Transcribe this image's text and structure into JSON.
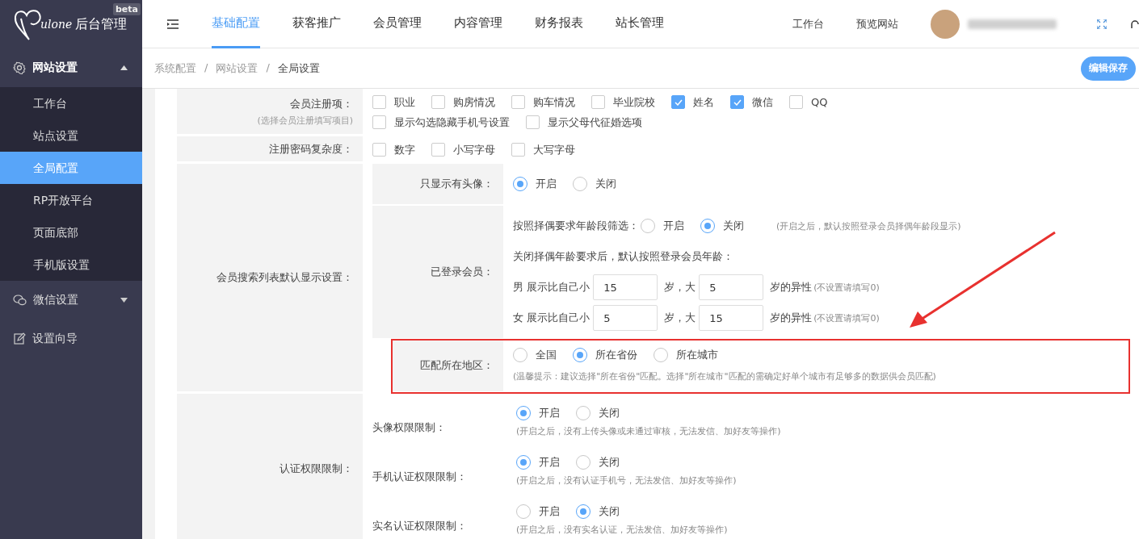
{
  "sidebar": {
    "logo": {
      "script": "ulone",
      "title": "后台管理",
      "badge": "beta"
    },
    "groups": [
      {
        "label": "网站设置",
        "kind": "submenu",
        "expanded": true,
        "children": [
          {
            "label": "工作台",
            "selected": false
          },
          {
            "label": "站点设置",
            "selected": false
          },
          {
            "label": "全局配置",
            "selected": true
          },
          {
            "label": "RP开放平台",
            "selected": false
          },
          {
            "label": "页面底部",
            "selected": false
          },
          {
            "label": "手机版设置",
            "selected": false
          }
        ]
      },
      {
        "label": "微信设置",
        "kind": "submenu",
        "expanded": false
      },
      {
        "label": "设置向导",
        "kind": "link"
      }
    ]
  },
  "top_nav": {
    "tabs": [
      {
        "label": "基础配置",
        "selected": true
      },
      {
        "label": "获客推广",
        "selected": false
      },
      {
        "label": "会员管理",
        "selected": false
      },
      {
        "label": "内容管理",
        "selected": false
      },
      {
        "label": "财务报表",
        "selected": false
      },
      {
        "label": "站长管理",
        "selected": false
      }
    ],
    "links": [
      "工作台",
      "预览网站"
    ]
  },
  "breadcrumb": {
    "items": [
      "系统配置",
      "网站设置",
      "全局设置"
    ],
    "separator": "/"
  },
  "save_button": "编辑保存",
  "form": [
    {
      "kind": "checks",
      "label": "会员注册项：",
      "hint": "(选择会员注册填写项目)",
      "lines": [
        [
          {
            "label": "职业",
            "checked": false
          },
          {
            "label": "购房情况",
            "checked": false
          },
          {
            "label": "购车情况",
            "checked": false
          },
          {
            "label": "毕业院校",
            "checked": false
          },
          {
            "label": "姓名",
            "checked": true
          },
          {
            "label": "微信",
            "checked": true
          },
          {
            "label": "QQ",
            "checked": false
          }
        ],
        [
          {
            "label": "显示勾选隐藏手机号设置",
            "checked": false
          },
          {
            "label": "显示父母代征婚选项",
            "checked": false
          }
        ]
      ]
    },
    {
      "kind": "checks",
      "label": "注册密码复杂度：",
      "lines": [
        [
          {
            "label": "数字",
            "checked": false
          },
          {
            "label": "小写字母",
            "checked": false
          },
          {
            "label": "大写字母",
            "checked": false
          }
        ]
      ]
    },
    {
      "kind": "nested",
      "label": "会员搜索列表默认显示设置：",
      "rows": [
        {
          "label": "只显示有头像：",
          "highlighted": false,
          "lines": [
            [
              {
                "kind": "radios",
                "options": [
                  {
                    "label": "开启",
                    "selected": true
                  },
                  {
                    "label": "关闭",
                    "selected": false
                  }
                ]
              }
            ]
          ]
        },
        {
          "label": "已登录会员：",
          "highlighted": false,
          "lines": [
            [
              {
                "kind": "text",
                "text": "按照择偶要求年龄段筛选："
              },
              {
                "kind": "radios",
                "options": [
                  {
                    "label": "开启",
                    "selected": false
                  },
                  {
                    "label": "关闭",
                    "selected": true
                  }
                ]
              },
              {
                "kind": "note",
                "text": "(开启之后，默认按照登录会员择偶年龄段显示)"
              }
            ],
            [
              {
                "kind": "text",
                "text": "关闭择偶年龄要求后，默认按照登录会员年龄："
              }
            ],
            [
              {
                "kind": "text",
                "text": "男 展示比自己小"
              },
              {
                "kind": "input",
                "value": "15"
              },
              {
                "kind": "text",
                "text": "岁，大"
              },
              {
                "kind": "input",
                "value": "5"
              },
              {
                "kind": "text",
                "text": "岁的异性"
              },
              {
                "kind": "note",
                "text": "(不设置请填写0)"
              }
            ],
            [
              {
                "kind": "text",
                "text": "女 展示比自己小"
              },
              {
                "kind": "input",
                "value": "5"
              },
              {
                "kind": "text",
                "text": "岁，大"
              },
              {
                "kind": "input",
                "value": "15"
              },
              {
                "kind": "text",
                "text": "岁的异性"
              },
              {
                "kind": "note",
                "text": "(不设置请填写0)"
              }
            ]
          ]
        },
        {
          "label": "匹配所在地区：",
          "highlighted": true,
          "lines": [
            [
              {
                "kind": "radios",
                "options": [
                  {
                    "label": "全国",
                    "selected": false
                  },
                  {
                    "label": "所在省份",
                    "selected": true
                  },
                  {
                    "label": "所在城市",
                    "selected": false
                  }
                ]
              }
            ],
            [
              {
                "kind": "note",
                "text": "(温馨提示：建议选择\"所在省份\"匹配。选择\"所在城市\"匹配的需确定好单个城市有足够多的数据供会员匹配)"
              }
            ]
          ]
        }
      ]
    },
    {
      "kind": "items",
      "label": "认证权限限制：",
      "items": [
        {
          "label": "头像权限限制：",
          "options": [
            {
              "label": "开启",
              "selected": true
            },
            {
              "label": "关闭",
              "selected": false
            }
          ],
          "note": "(开启之后，没有上传头像或未通过审核，无法发信、加好友等操作)"
        },
        {
          "label": "手机认证权限限制：",
          "options": [
            {
              "label": "开启",
              "selected": true
            },
            {
              "label": "关闭",
              "selected": false
            }
          ],
          "note": "(开启之后，没有认证手机号，无法发信、加好友等操作)"
        },
        {
          "label": "实名认证权限限制：",
          "options": [
            {
              "label": "开启",
              "selected": false
            },
            {
              "label": "关闭",
              "selected": true
            }
          ],
          "note": "(开启之后，没有实名认证，无法发信、加好友等操作)"
        }
      ]
    }
  ]
}
